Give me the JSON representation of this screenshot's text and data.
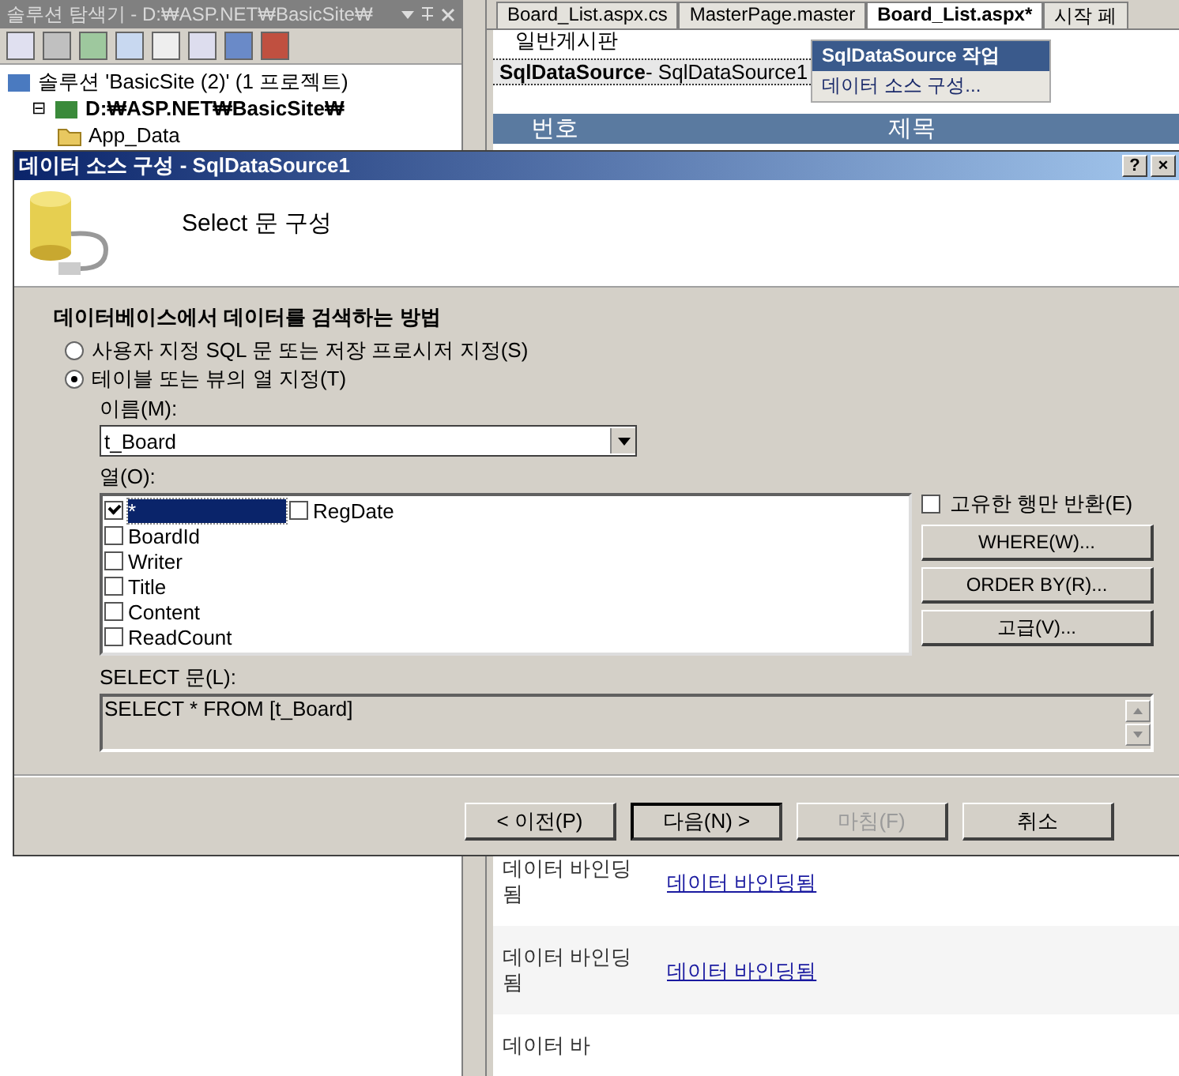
{
  "explorer": {
    "title": "솔루션 탐색기 - D:₩ASP.NET₩BasicSite₩",
    "tree": [
      {
        "label": "솔루션 'BasicSite (2)' (1 프로젝트)",
        "kind": "solution",
        "children": [
          {
            "label": "D:₩ASP.NET₩BasicSite₩",
            "kind": "project",
            "expanded": true,
            "expander": "⊟",
            "children": [
              {
                "label": "App_Data",
                "kind": "folder"
              }
            ]
          }
        ]
      }
    ]
  },
  "designer": {
    "tabs": [
      {
        "label": "Board_List.aspx.cs",
        "selected": false
      },
      {
        "label": "MasterPage.master",
        "selected": false
      },
      {
        "label": "Board_List.aspx*",
        "selected": true
      },
      {
        "label": "시작 페",
        "selected": false
      }
    ],
    "page_heading": "일반게시판",
    "datasource": {
      "type": "SqlDataSource",
      "name": " - SqlDataSource1"
    },
    "smart_tag": {
      "title": "SqlDataSource 작업",
      "items": [
        "데이터 소스 구성..."
      ]
    },
    "grid_headers": [
      "번호",
      "제목"
    ],
    "rows": [
      {
        "cell": "데이터 바인딩됨",
        "link": "데이터 바인딩됨"
      },
      {
        "cell": "데이터 바인딩됨",
        "link": "데이터 바인딩됨"
      },
      {
        "cell": "데이터 바"
      }
    ]
  },
  "dialog": {
    "title": "데이터 소스 구성 - SqlDataSource1",
    "help": "?",
    "close": "×",
    "heading": "Select 문 구성",
    "section": "데이터베이스에서 데이터를 검색하는 방법",
    "options": [
      {
        "label": "사용자 지정 SQL 문 또는 저장 프로시저 지정(S)",
        "selected": false
      },
      {
        "label": "테이블 또는 뷰의 열 지정(T)",
        "selected": true
      }
    ],
    "name_label": "이름(M):",
    "name_value": "t_Board",
    "columns_label": "열(O):",
    "columns": [
      {
        "label": "*",
        "checked": true,
        "selected": true
      },
      {
        "label": "BoardId",
        "checked": false,
        "selected": false
      },
      {
        "label": "Writer",
        "checked": false,
        "selected": false
      },
      {
        "label": "Title",
        "checked": false,
        "selected": false
      },
      {
        "label": "Content",
        "checked": false,
        "selected": false
      },
      {
        "label": "ReadCount",
        "checked": false,
        "selected": false
      },
      {
        "label": "RegDate",
        "checked": false,
        "selected": false
      }
    ],
    "distinct": {
      "label": "고유한 행만 반환(E)",
      "checked": false
    },
    "side_buttons": [
      "WHERE(W)...",
      "ORDER BY(R)...",
      "고급(V)..."
    ],
    "select_label": "SELECT 문(L):",
    "select_text": "SELECT * FROM [t_Board]",
    "buttons": [
      {
        "label": "< 이전(P)",
        "disabled": false,
        "default": false
      },
      {
        "label": "다음(N) >",
        "disabled": false,
        "default": true
      },
      {
        "label": "마침(F)",
        "disabled": true,
        "default": false
      },
      {
        "label": "취소",
        "disabled": false,
        "default": false
      }
    ]
  }
}
